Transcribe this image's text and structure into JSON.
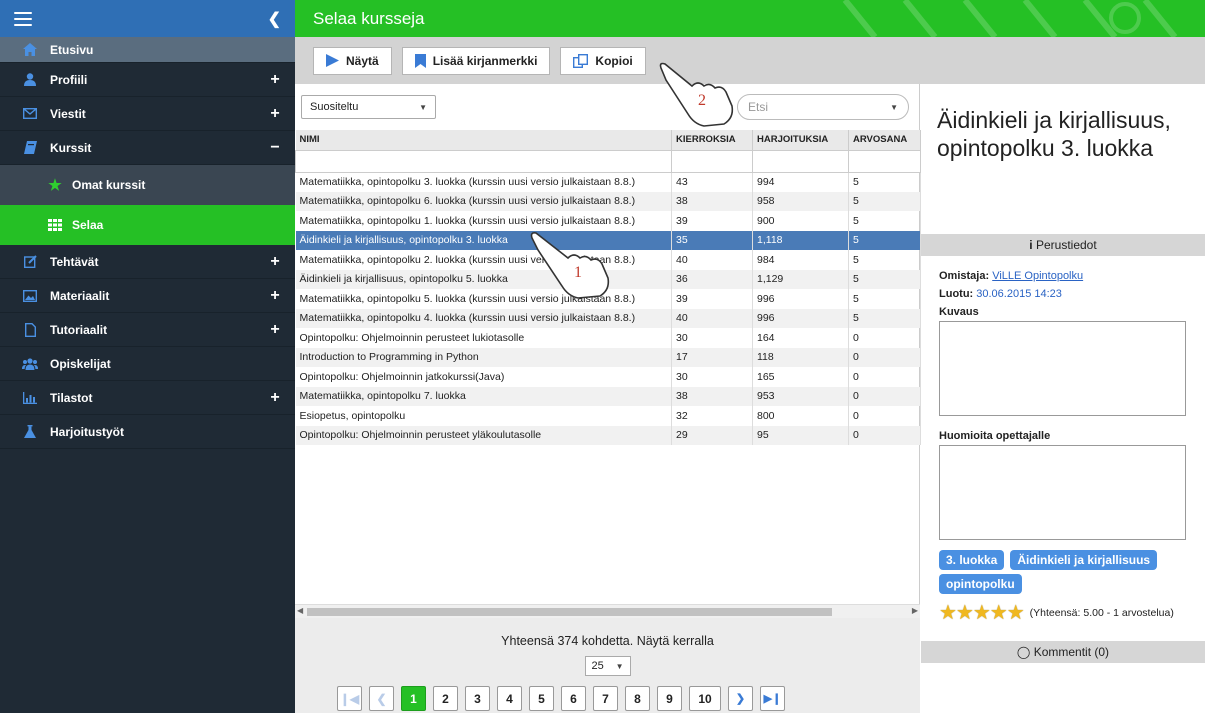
{
  "sidebar": {
    "items": [
      {
        "label": "Etusivu",
        "icon": "home-icon",
        "expander": ""
      },
      {
        "label": "Profiili",
        "icon": "user-icon",
        "expander": "+"
      },
      {
        "label": "Viestit",
        "icon": "envelope-icon",
        "expander": "+"
      },
      {
        "label": "Kurssit",
        "icon": "book-icon",
        "expander": "−"
      },
      {
        "label": "Tehtävät",
        "icon": "edit-icon",
        "expander": "+"
      },
      {
        "label": "Materiaalit",
        "icon": "image-icon",
        "expander": "+"
      },
      {
        "label": "Tutoriaalit",
        "icon": "document-icon",
        "expander": "+"
      },
      {
        "label": "Opiskelijat",
        "icon": "users-icon",
        "expander": ""
      },
      {
        "label": "Tilastot",
        "icon": "bar-chart-icon",
        "expander": "+"
      },
      {
        "label": "Harjoitustyöt",
        "icon": "flask-icon",
        "expander": ""
      }
    ],
    "subitems": [
      {
        "label": "Omat kurssit",
        "icon": "star-icon"
      },
      {
        "label": "Selaa",
        "icon": "grid-icon"
      }
    ]
  },
  "header": {
    "title": "Selaa kursseja"
  },
  "toolbar": {
    "show_label": "Näytä",
    "bookmark_label": "Lisää kirjanmerkki",
    "copy_label": "Kopioi"
  },
  "filters": {
    "sort_value": "Suositeltu",
    "search_placeholder": "Etsi"
  },
  "table": {
    "columns": [
      "NIMI",
      "KIERROKSIA",
      "HARJOITUKSIA",
      "ARVOSANA"
    ],
    "rows": [
      [
        "Matematiikka, opintopolku 3. luokka (kurssin uusi versio julkaistaan 8.8.)",
        "43",
        "994",
        "5"
      ],
      [
        "Matematiikka, opintopolku 6. luokka (kurssin uusi versio julkaistaan 8.8.)",
        "38",
        "958",
        "5"
      ],
      [
        "Matematiikka, opintopolku 1. luokka (kurssin uusi versio julkaistaan 8.8.)",
        "39",
        "900",
        "5"
      ],
      [
        "Äidinkieli ja kirjallisuus, opintopolku 3. luokka",
        "35",
        "1,118",
        "5"
      ],
      [
        "Matematiikka, opintopolku 2. luokka (kurssin uusi versio julkaistaan 8.8.)",
        "40",
        "984",
        "5"
      ],
      [
        "Äidinkieli ja kirjallisuus, opintopolku 5. luokka",
        "36",
        "1,129",
        "5"
      ],
      [
        "Matematiikka, opintopolku 5. luokka (kurssin uusi versio julkaistaan 8.8.)",
        "39",
        "996",
        "5"
      ],
      [
        "Matematiikka, opintopolku 4. luokka (kurssin uusi versio julkaistaan 8.8.)",
        "40",
        "996",
        "5"
      ],
      [
        "Opintopolku: Ohjelmoinnin perusteet lukiotasolle",
        "30",
        "164",
        "0"
      ],
      [
        "Introduction to Programming in Python",
        "17",
        "118",
        "0"
      ],
      [
        "Opintopolku: Ohjelmoinnin jatkokurssi(Java)",
        "30",
        "165",
        "0"
      ],
      [
        "Matematiikka, opintopolku 7. luokka",
        "38",
        "953",
        "0"
      ],
      [
        "Esiopetus, opintopolku",
        "32",
        "800",
        "0"
      ],
      [
        "Opintopolku: Ohjelmoinnin perusteet yläkoulutasolle",
        "29",
        "95",
        "0"
      ]
    ],
    "selected_row": 3
  },
  "footer": {
    "total_text": "Yhteensä 374 kohdetta. Näytä kerralla",
    "per_page": "25",
    "pages": [
      "1",
      "2",
      "3",
      "4",
      "5",
      "6",
      "7",
      "8",
      "9",
      "10"
    ],
    "current_page": "1"
  },
  "detail": {
    "title": "Äidinkieli ja kirjallisuus, opintopolku 3. luokka",
    "section_basic": "Perustiedot",
    "owner_label": "Omistaja:",
    "owner_value": "ViLLE Opintopolku",
    "created_label": "Luotu:",
    "created_value": "30.06.2015 14:23",
    "description_label": "Kuvaus",
    "notes_label": "Huomioita opettajalle",
    "tags": [
      "3. luokka",
      "Äidinkieli ja kirjallisuus",
      "opintopolku"
    ],
    "rating_text": "(Yhteensä: 5.00 - 1 arvostelua)",
    "rating_value": 5,
    "comments_label": "Kommentit (0)"
  },
  "annotations": {
    "step1": "1",
    "step2": "2"
  },
  "colors": {
    "sidebar": "#1f2a35",
    "accent_green": "#25c025",
    "brand_blue": "#2f6fb5",
    "selected_row": "#4a7bb7",
    "tag_blue": "#4a90e2"
  }
}
